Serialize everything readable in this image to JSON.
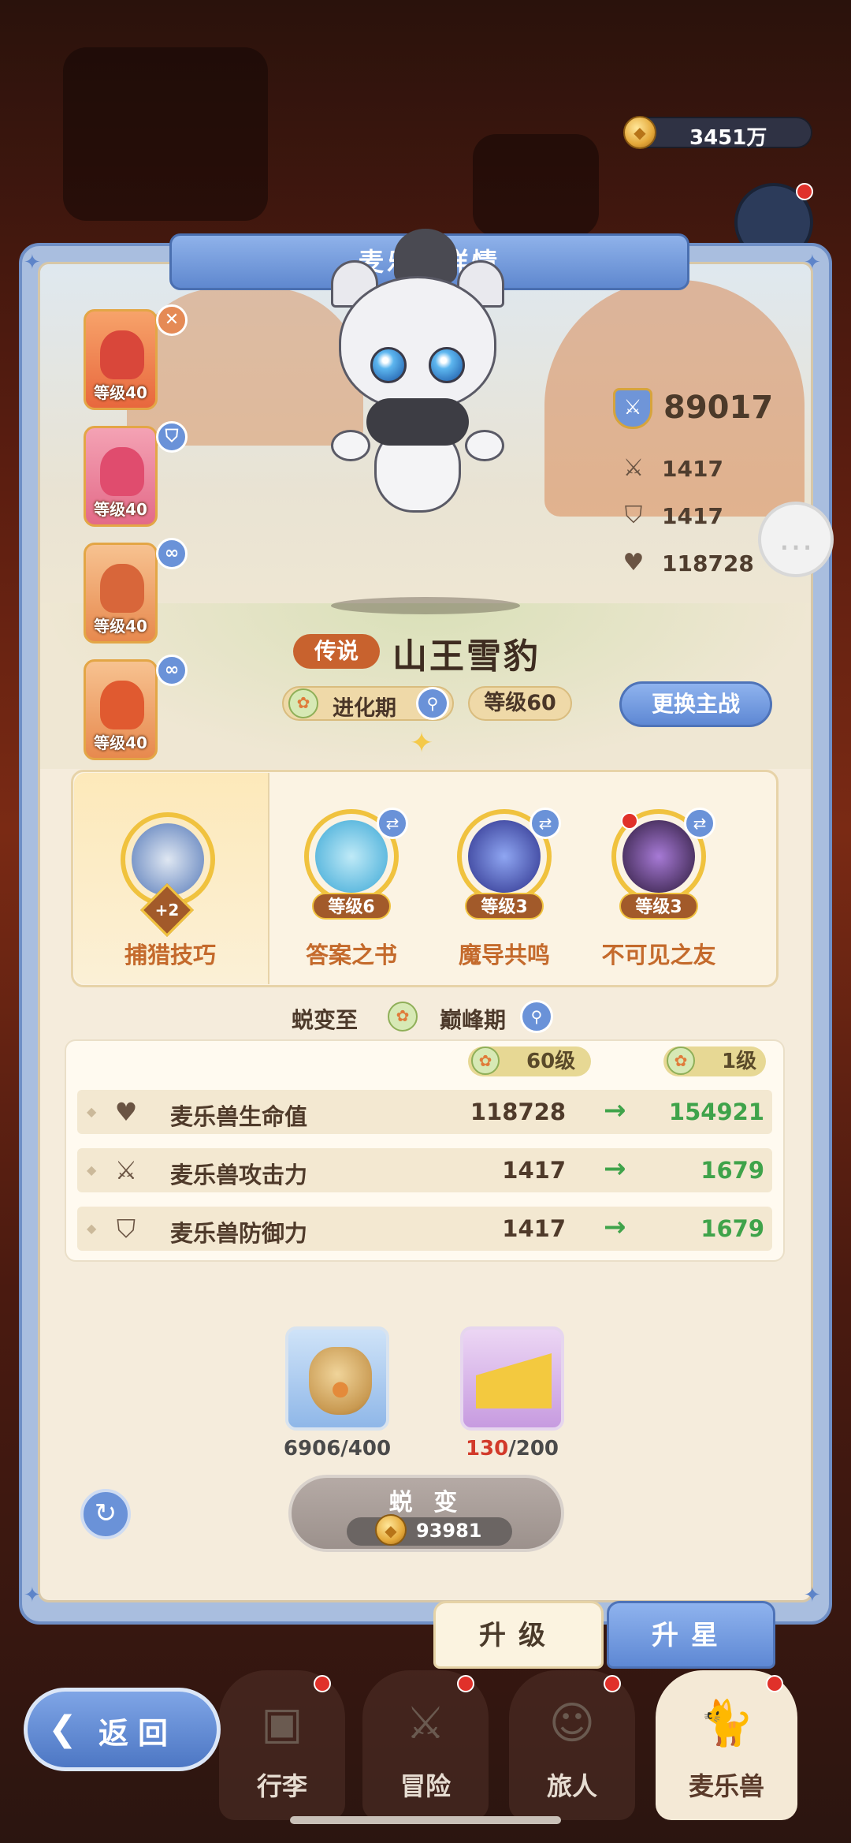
{
  "currency": {
    "amount": "3451万",
    "icon": "gold-coin-icon"
  },
  "panel": {
    "title": "麦乐兽详情"
  },
  "team": [
    {
      "level": "等级40",
      "badge": "✕",
      "badge_color": "#e58a55"
    },
    {
      "level": "等级40",
      "badge": "shield",
      "badge_color": "#6a92d8"
    },
    {
      "level": "等级40",
      "badge": "link",
      "badge_color": "#6a92d8"
    },
    {
      "level": "等级40",
      "badge": "link",
      "badge_color": "#6a92d8"
    }
  ],
  "stats": {
    "power": "89017",
    "attack": "1417",
    "defense": "1417",
    "hp": "118728"
  },
  "pet": {
    "rarity": "传说",
    "name": "山王雪豹",
    "stage": "进化期",
    "level": "等级60",
    "switch_label": "更换主战"
  },
  "skills": [
    {
      "name": "捕猎技巧",
      "level": "+2",
      "selected": true
    },
    {
      "name": "答案之书",
      "level": "等级6"
    },
    {
      "name": "魔导共鸣",
      "level": "等级3"
    },
    {
      "name": "不可见之友",
      "level": "等级3"
    }
  ],
  "evolve": {
    "label": "蜕变至",
    "target_stage": "巅峰期"
  },
  "compare": {
    "current_level": "60级",
    "next_level": "1级",
    "rows": [
      {
        "label": "麦乐兽生命值",
        "current": "118728",
        "next": "154921",
        "icon": "heart-icon"
      },
      {
        "label": "麦乐兽攻击力",
        "current": "1417",
        "next": "1679",
        "icon": "swords-icon"
      },
      {
        "label": "麦乐兽防御力",
        "current": "1417",
        "next": "1679",
        "icon": "shield-icon"
      }
    ]
  },
  "materials": [
    {
      "name": "food-bag",
      "count": "6906",
      "required": "/400"
    },
    {
      "name": "cheese",
      "count": "130",
      "required": "/200",
      "count_color": "#d23a2a"
    }
  ],
  "evolve_button": {
    "label": "蜕 变",
    "cost": "93981"
  },
  "tabs": {
    "upgrade": "升级",
    "star": "升星"
  },
  "nav": {
    "back": "返回",
    "items": [
      "行李",
      "冒险",
      "旅人",
      "麦乐兽"
    ]
  },
  "colors": {
    "accent": "#6a92d8",
    "increase": "#3fa34a",
    "skill_text": "#c46a2c"
  }
}
